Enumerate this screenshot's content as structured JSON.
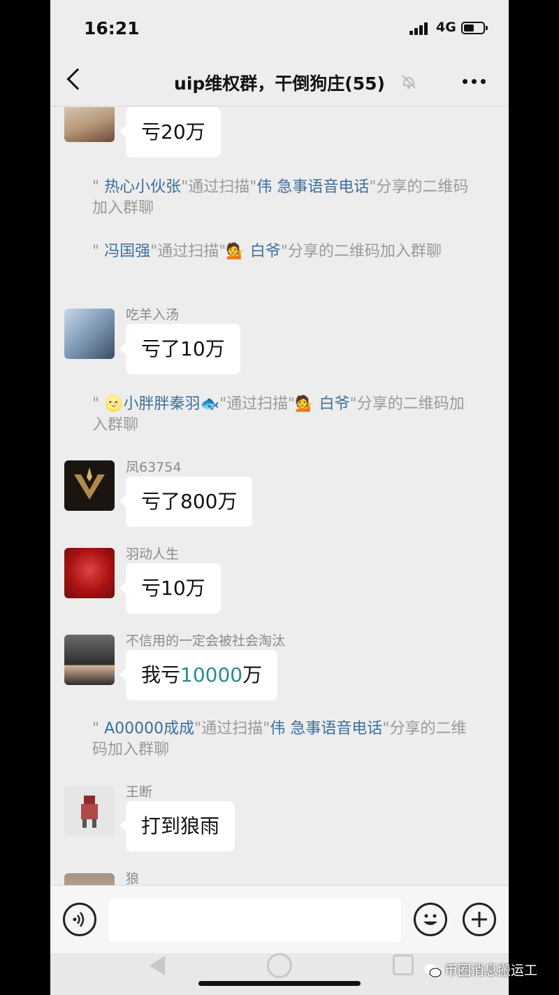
{
  "status_bar": {
    "time": "16:21",
    "network": "4G"
  },
  "nav": {
    "title": "uip维权群，干倒狗庄(55)"
  },
  "messages": [
    {
      "text": "亏20万"
    },
    {
      "sender": "吃羊入汤",
      "text": "亏了10万"
    },
    {
      "sender": "凤63754",
      "text": "亏了800万"
    },
    {
      "sender": "羽动人生",
      "text": "亏10万"
    },
    {
      "sender": "不信用的一定会被社会淘汰",
      "text_prefix": "我亏",
      "text_highlight": "10000",
      "text_suffix": "万"
    },
    {
      "sender": "王断",
      "text": "打到狼雨"
    },
    {
      "sender": "狼"
    }
  ],
  "system_notices": [
    {
      "q": "\"",
      "name1": "热心小伙张",
      "mid": "\"通过扫描\"",
      "name2": "伟 急事语音电话",
      "tail": "\"分享的二维码加入群聊"
    },
    {
      "q": "\"",
      "name1": "冯国强",
      "mid": "\"通过扫描\"",
      "emoji": "💁",
      "name2": "白爷",
      "tail": "\"分享的二维码加入群聊"
    },
    {
      "q": "\"",
      "emoji1": "🌝",
      "name1": "小胖胖秦羽",
      "emoji2": "🐟",
      "mid": "\"通过扫描\"",
      "emoji3": "💁",
      "name2": "白爷",
      "tail": "\"分享的二维码加入群聊"
    },
    {
      "q": "\"",
      "name1": "A00000成成",
      "mid": "\"通过扫描\"",
      "name2": "伟 急事语音电话",
      "tail": "\"分享的二维码加入群聊"
    }
  ],
  "watermark": "币圈消息搬运工",
  "colors": {
    "background": "#ededed",
    "bubble": "#ffffff",
    "notice_name": "#3f6e9a",
    "highlight": "#2a8c8c"
  }
}
